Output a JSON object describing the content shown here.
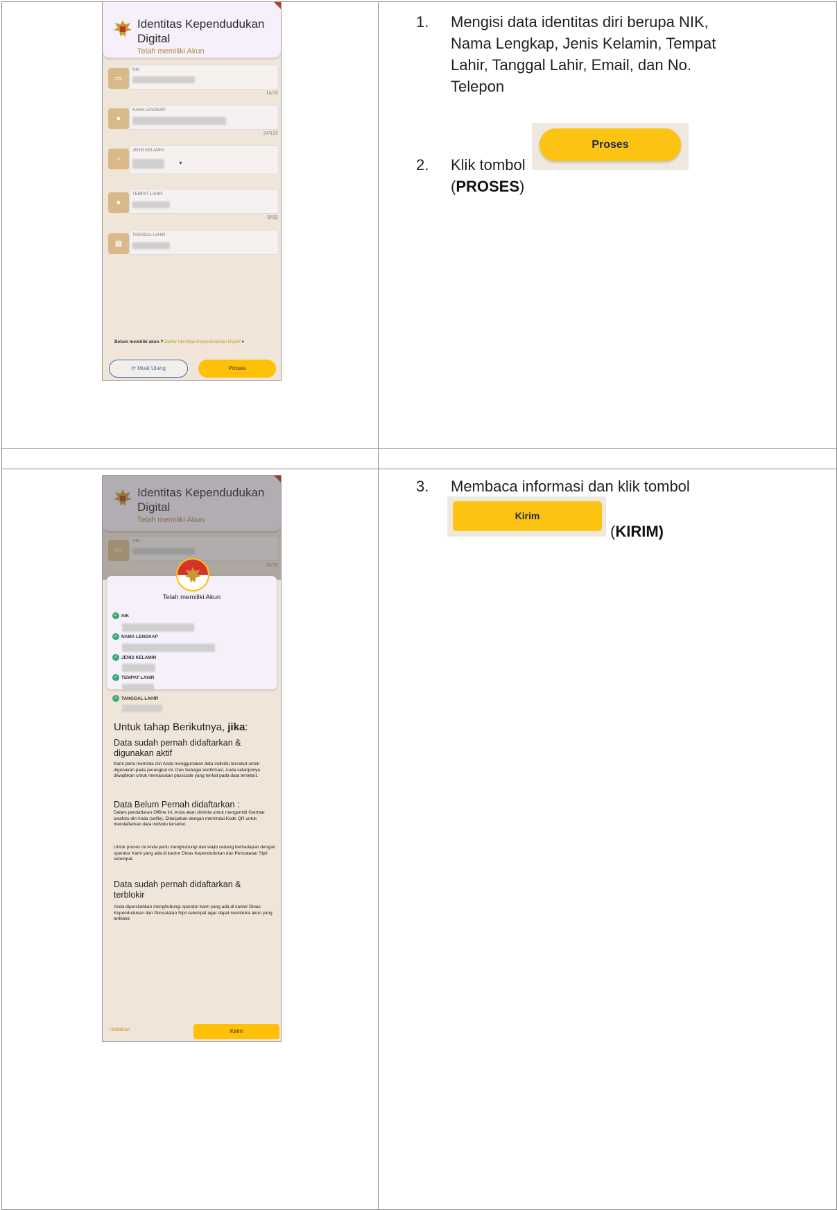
{
  "step1": {
    "num": "1.",
    "line1": "Mengisi data identitas diri berupa NIK,",
    "line2": "Nama Lengkap, Jenis Kelamin, Tempat",
    "line3": "Lahir, Tanggal Lahir, Email, dan No.",
    "line4": "Telepon"
  },
  "step2": {
    "num": "2.",
    "text": "Klik tombol",
    "open": "(",
    "bold": "PROSES",
    "close": ")",
    "button_label": "Proses"
  },
  "step3": {
    "num": "3.",
    "text": "Membaca informasi dan klik  tombol",
    "open": "(",
    "bold": "KIRIM)",
    "button_label": "Kirim"
  },
  "screen1": {
    "title_line1": "Identitas Kependudukan",
    "title_line2": "Digital",
    "subtitle": "Telah memiliki Akun",
    "fields": [
      {
        "label": "NIK:",
        "counter": "16/16"
      },
      {
        "label": "NAMA LENGKAP:",
        "counter": "24/120"
      },
      {
        "label": "JENIS KELAMIN:",
        "counter": ""
      },
      {
        "label": "TEMPAT LAHIR:",
        "counter": "9/60"
      },
      {
        "label": "TANGGAL LAHIR:",
        "counter": ""
      }
    ],
    "footer_text": "Belum memiliki akun ? ",
    "footer_link": "Daftar Identitas Kependudukan Digital",
    "reload_label": "Muat Ulang",
    "proses_label": "Proses"
  },
  "screen2": {
    "title_line1": "Identitas Kependudukan",
    "title_line2": "Digital",
    "subtitle": "Telah memiliki Akun",
    "nik_label": "NIK:",
    "nik_counter": "16/16",
    "card_title": "Telah memiliki Akun",
    "checks": [
      "NIK",
      "NAMA LENGKAP",
      "JENIS KELAMIN",
      "TEMPAT LAHIR",
      "TANGGAL LAHIR"
    ],
    "heading_a": "Untuk tahap Berikutnya, ",
    "heading_b": "jika",
    "heading_c": ":",
    "sec1_title": "Data sudah pernah didaftarkan & digunakan aktif",
    "sec1_body": "Kami perlu meminta izin Anda menggunakan data individu tersebut untuk digunakan pada perangkat ini. Dan Sebagai konfirmasi, Anda selanjutnya diwajibkan untuk memasukan passcode yang terikat pada data tersebut.",
    "sec2_title": "Data Belum Pernah didaftarkan :",
    "sec2_body": "Dalam pendaftaran Offline ini, Anda akan diminta untuk mengambil Gambar swafoto diri Anda (selfie). Dilanjutkan dengan memindai Kode QR untuk mendaftarkan data individu tersebut.",
    "sec2_body2": "Untuk proses ini Anda perlu menghubungi dan wajib sedang berhadapan dengan operator Kami yang ada di kantor Dinas Kependudukan dan Pencatatan Sipil setempat.",
    "sec3_title": "Data sudah pernah didaftarkan & terblokir",
    "sec3_body": "Anda dipersilahkan menghubungi operator kami yang ada di kantor Dinas Kependudukan dan Pencatatan Sipil setempat agar dapat membuka akun yang terblokir.",
    "cancel_label": "Batalkan",
    "kirim_label": "Kirim"
  }
}
